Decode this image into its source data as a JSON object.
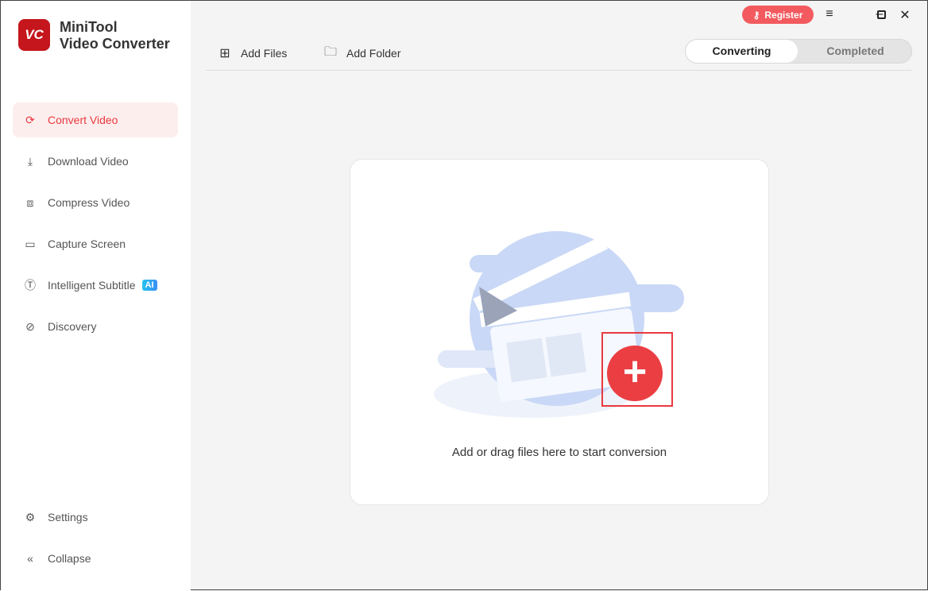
{
  "app": {
    "logo_text": "VC",
    "name_line1": "MiniTool",
    "name_line2": "Video Converter"
  },
  "sidebar": {
    "items": [
      {
        "label": "Convert Video",
        "icon": "convert-icon",
        "active": true
      },
      {
        "label": "Download Video",
        "icon": "download-icon"
      },
      {
        "label": "Compress Video",
        "icon": "compress-icon"
      },
      {
        "label": "Capture Screen",
        "icon": "camera-icon"
      },
      {
        "label": "Intelligent Subtitle",
        "icon": "subtitle-icon",
        "badge": "AI"
      },
      {
        "label": "Discovery",
        "icon": "compass-icon"
      }
    ],
    "settings": "Settings",
    "collapse": "Collapse"
  },
  "toolbar": {
    "add_files": "Add Files",
    "add_folder": "Add Folder"
  },
  "tabs": {
    "converting": "Converting",
    "completed": "Completed"
  },
  "titlebar": {
    "register": "Register"
  },
  "main": {
    "hint": "Add or drag files here to start conversion"
  },
  "colors": {
    "accent": "#e8393f",
    "register": "#f25a5f"
  }
}
